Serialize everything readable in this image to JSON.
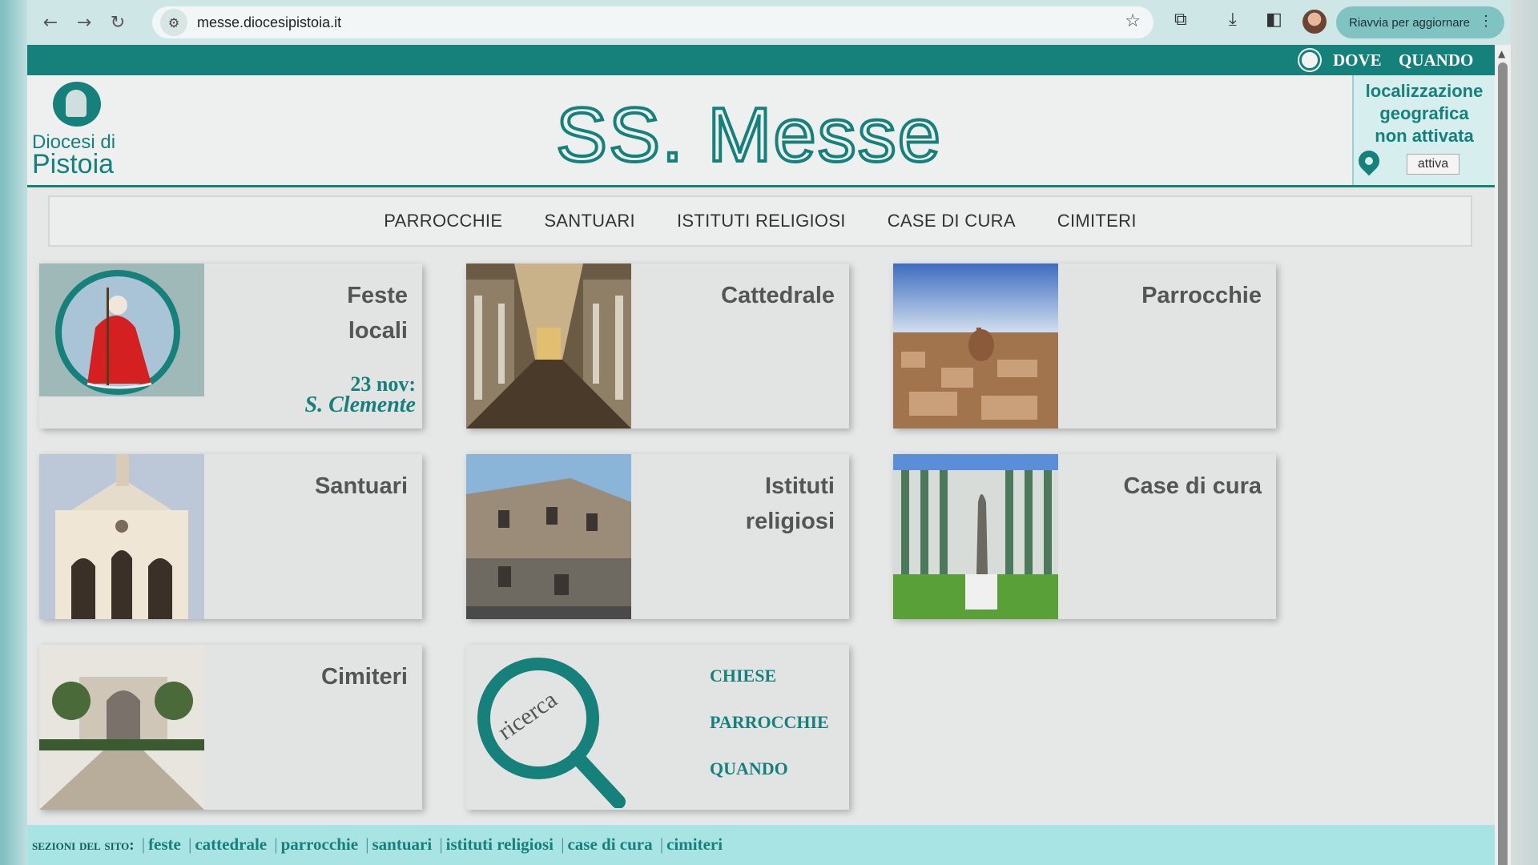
{
  "browser": {
    "url": "messe.diocesipistoia.it",
    "restart_label": "Riavvia per aggiornare",
    "back_icon": "←",
    "forward_icon": "→",
    "reload_icon": "↻",
    "star_icon": "☆",
    "tune_icon": "⚙",
    "extensions_icon": "⧉",
    "download_icon": "⤓",
    "sidepanel_icon": "◧",
    "menu_icon": "⋮"
  },
  "topbar": {
    "dove": "DOVE",
    "quando": "QUANDO"
  },
  "header": {
    "logo_line1": "Diocesi di",
    "logo_line2": "Pistoia",
    "title": "SS. Messe",
    "geo_text_1": "localizzazione",
    "geo_text_2": "geografica",
    "geo_text_3": "non attivata",
    "geo_button": "attiva"
  },
  "menu": [
    "PARROCCHIE",
    "SANTUARI",
    "ISTITUTI RELIGIOSI",
    "CASE DI CURA",
    "CIMITERI"
  ],
  "cards": {
    "feste_1": "Feste",
    "feste_2": "locali",
    "feste_date": "23 nov:",
    "feste_saint": "S. Clemente",
    "cattedrale": "Cattedrale",
    "parrocchie": "Parrocchie",
    "santuari": "Santuari",
    "istituti_1": "Istituti",
    "istituti_2": "religiosi",
    "case": "Case di cura",
    "cimiteri": "Cimiteri",
    "ricerca": "ricerca",
    "search_links": [
      "CHIESE",
      "PARROCCHIE",
      "QUANDO"
    ]
  },
  "footer": {
    "label": "sezioni del sito:",
    "links": [
      "feste",
      "cattedrale",
      "parrocchie",
      "santuari",
      "istituti religiosi",
      "case di cura",
      "cimiteri"
    ]
  },
  "colors": {
    "accent": "#16807a",
    "footer_bg": "#a8e4e4",
    "card_bg": "#e2e4e4"
  }
}
